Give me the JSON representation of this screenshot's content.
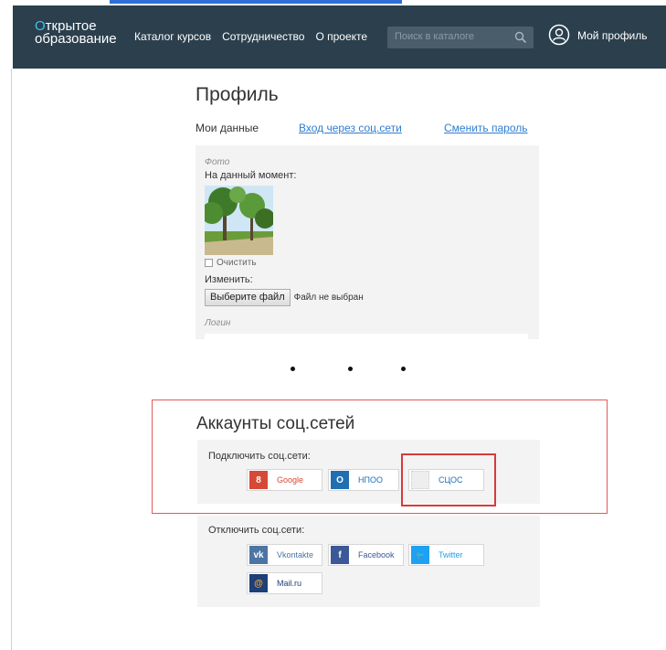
{
  "header": {
    "logo_line1": "ткрытое",
    "logo_letter": "О",
    "logo_line2": "образование",
    "nav": [
      "Каталог курсов",
      "Сотрудничество",
      "О проекте"
    ],
    "search_placeholder": "Поиск в каталоге",
    "profile_label": "Мой профиль"
  },
  "profile": {
    "title": "Профиль",
    "tab_data": "Мои данные",
    "tab_social": "Вход через соц.сети",
    "tab_password": "Сменить пароль",
    "photo_label": "Фото",
    "current_label": "На данный момент:",
    "clear_label": "Очистить",
    "change_label": "Изменить:",
    "file_button": "Выберите файл",
    "file_status": "Файл не выбран",
    "login_label": "Логин"
  },
  "social": {
    "title": "Аккаунты соц.сетей",
    "connect_label": "Подключить соц.сети:",
    "connect_buttons": [
      {
        "label": "Google",
        "icon": "google-icon",
        "glyph": "8",
        "color": "#d64937",
        "text_color": "#d64937"
      },
      {
        "label": "НПОО",
        "icon": "npoo-icon",
        "glyph": "O",
        "color": "#1f6fb2",
        "text_color": "#1f6fb2"
      },
      {
        "label": "СЦОС",
        "icon": "scos-icon",
        "glyph": "",
        "color": "#eeeeee",
        "text_color": "#1f6fb2"
      }
    ],
    "disconnect_label": "Отключить соц.сети:",
    "disconnect_buttons": [
      {
        "label": "Vkontakte",
        "icon": "vk-icon",
        "glyph": "vk",
        "color": "#4c75a3",
        "text_color": "#4c75a3"
      },
      {
        "label": "Facebook",
        "icon": "facebook-icon",
        "glyph": "f",
        "color": "#3b5998",
        "text_color": "#3b5998"
      },
      {
        "label": "Twitter",
        "icon": "twitter-icon",
        "glyph": "🐦",
        "color": "#1da1f2",
        "text_color": "#1da1f2"
      },
      {
        "label": "Mail.ru",
        "icon": "mailru-icon",
        "glyph": "@",
        "color": "#1e3f77",
        "text_color": "#1e3f77"
      }
    ]
  },
  "colors": {
    "header_bg": "#2b3f4d",
    "link": "#2e7dd1",
    "annotation_red": "#d83a3a"
  }
}
